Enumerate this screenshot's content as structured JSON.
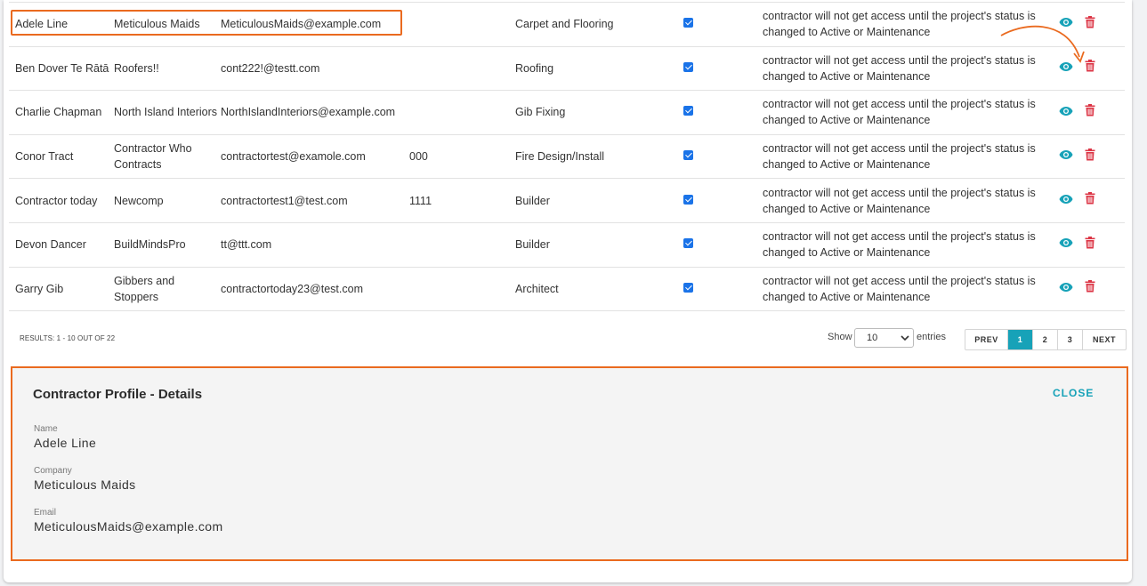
{
  "table": {
    "rows": [
      {
        "name": "Adele Line",
        "company": "Meticulous Maids",
        "email": "MeticulousMaids@example.com",
        "phone": "",
        "trade": "Carpet and Flooring",
        "note": "contractor will not get access until the project's status is changed to Active or Maintenance"
      },
      {
        "name": "Ben Dover Te Rātā",
        "company": "Roofers!!",
        "email": "cont222!@testt.com",
        "phone": "",
        "trade": "Roofing",
        "note": "contractor will not get access until the project's status is changed to Active or Maintenance"
      },
      {
        "name": "Charlie Chapman",
        "company": "North Island Interiors",
        "email": "NorthIslandInteriors@example.com",
        "phone": "",
        "trade": "Gib Fixing",
        "note": "contractor will not get access until the project's status is changed to Active or Maintenance"
      },
      {
        "name": "Conor Tract",
        "company": "Contractor Who Contracts",
        "email": "contractortest@examole.com",
        "phone": "000",
        "trade": "Fire Design/Install",
        "note": "contractor will not get access until the project's status is changed to Active or Maintenance"
      },
      {
        "name": "Contractor today",
        "company": "Newcomp",
        "email": "contractortest1@test.com",
        "phone": "1111",
        "trade": "Builder",
        "note": "contractor will not get access until the project's status is changed to Active or Maintenance"
      },
      {
        "name": "Devon Dancer",
        "company": "BuildMindsPro",
        "email": "tt@ttt.com",
        "phone": "",
        "trade": "Builder",
        "note": "contractor will not get access until the project's status is changed to Active or Maintenance"
      },
      {
        "name": "Garry Gib",
        "company": "Gibbers and Stoppers",
        "email": "contractortoday23@test.com",
        "phone": "",
        "trade": "Architect",
        "note": "contractor will not get access until the project's status is changed to Active or Maintenance"
      }
    ],
    "icons": {
      "view": "eye-icon",
      "delete": "trash-icon",
      "checkbox": "checked-checkbox"
    },
    "colors": {
      "view": "#17a2b8",
      "delete": "#dc3545",
      "checkbox": "#1a73e8",
      "highlight": "#ea6a1f"
    }
  },
  "footer": {
    "results": "RESULTS: 1 - 10 OUT OF 22",
    "show_label": "Show",
    "entries_label": "entries",
    "page_size": "10",
    "pagination": {
      "prev": "PREV",
      "pages": [
        "1",
        "2",
        "3"
      ],
      "active_page": "1",
      "next": "NEXT"
    }
  },
  "profile": {
    "title": "Contractor Profile - Details",
    "close_label": "CLOSE",
    "fields": [
      {
        "label": "Name",
        "value": "Adele Line"
      },
      {
        "label": "Company",
        "value": "Meticulous Maids"
      },
      {
        "label": "Email",
        "value": "MeticulousMaids@example.com"
      }
    ]
  }
}
